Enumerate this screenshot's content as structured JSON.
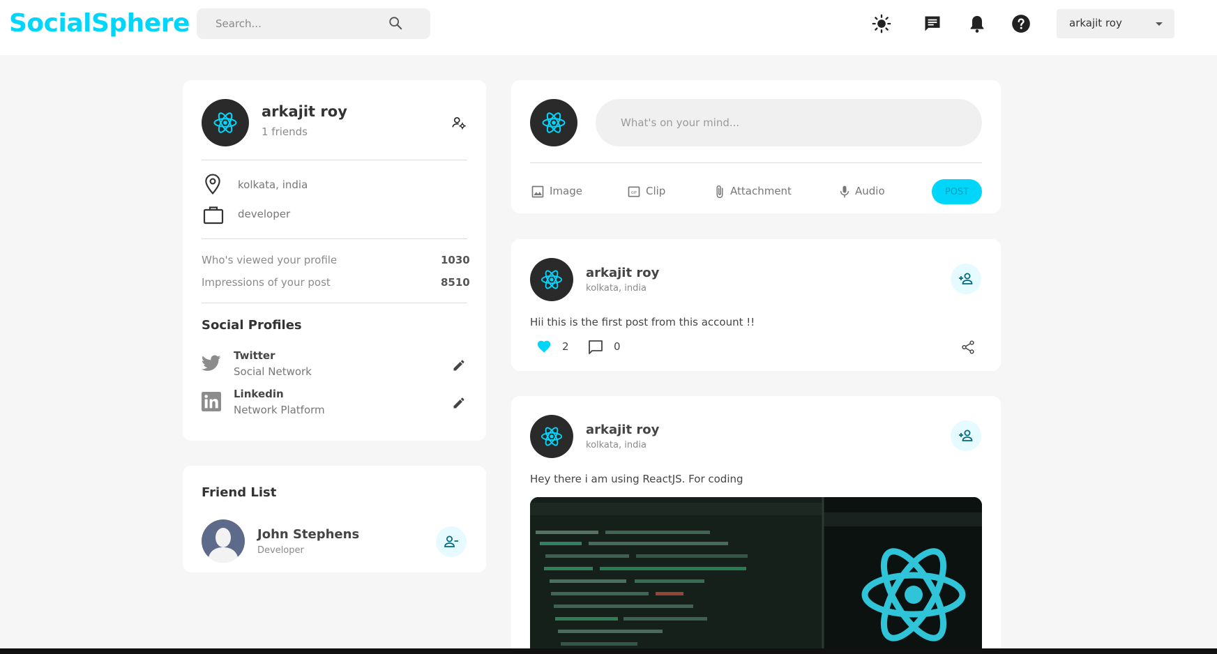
{
  "navbar": {
    "logo": "SocialSphere",
    "search_placeholder": "Search...",
    "icons": [
      "light-mode-icon",
      "message-icon",
      "notification-icon",
      "help-icon"
    ],
    "user_select": "arkajit roy"
  },
  "profile": {
    "name": "arkajit roy",
    "friends": "1 friends",
    "location": "kolkata, india",
    "occupation": "developer",
    "stats": [
      {
        "label": "Who's viewed your profile",
        "value": "1030"
      },
      {
        "label": "Impressions of your post",
        "value": "8510"
      }
    ],
    "social_title": "Social Profiles",
    "socials": [
      {
        "name": "Twitter",
        "type": "Social Network"
      },
      {
        "name": "Linkedin",
        "type": "Network Platform"
      }
    ]
  },
  "friends_widget": {
    "title": "Friend List",
    "friends": [
      {
        "name": "John Stephens",
        "occupation": "Developer"
      }
    ]
  },
  "composer": {
    "placeholder": "What's on your mind...",
    "actions": [
      "Image",
      "Clip",
      "Attachment",
      "Audio"
    ],
    "post_label": "POST"
  },
  "posts": [
    {
      "author": "arkajit roy",
      "location": "kolkata, india",
      "text": "Hii this is the first post from this account !!",
      "likes": "2",
      "comments": "0"
    },
    {
      "author": "arkajit roy",
      "location": "kolkata, india",
      "text": "Hey there i am using ReactJS. For coding"
    }
  ],
  "colors": {
    "primary": "#00d5fa",
    "background": "#f6f6f6",
    "card": "#ffffff",
    "primary_light": "#e6fbff"
  }
}
